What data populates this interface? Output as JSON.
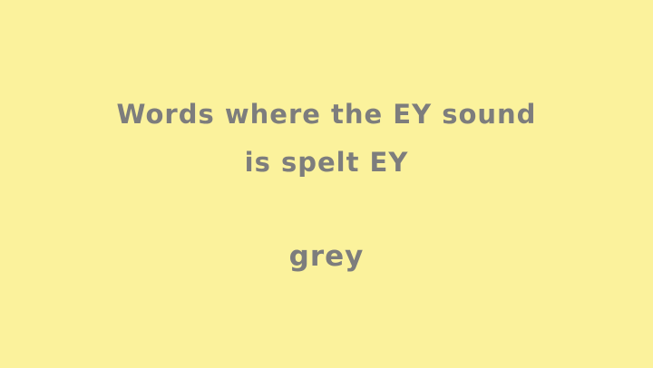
{
  "slide": {
    "background_color": "#FBF29C",
    "text_color": "#7D7D7D",
    "heading_line1": "Words where the EY sound",
    "heading_line2": "is spelt EY",
    "word": "grey"
  }
}
